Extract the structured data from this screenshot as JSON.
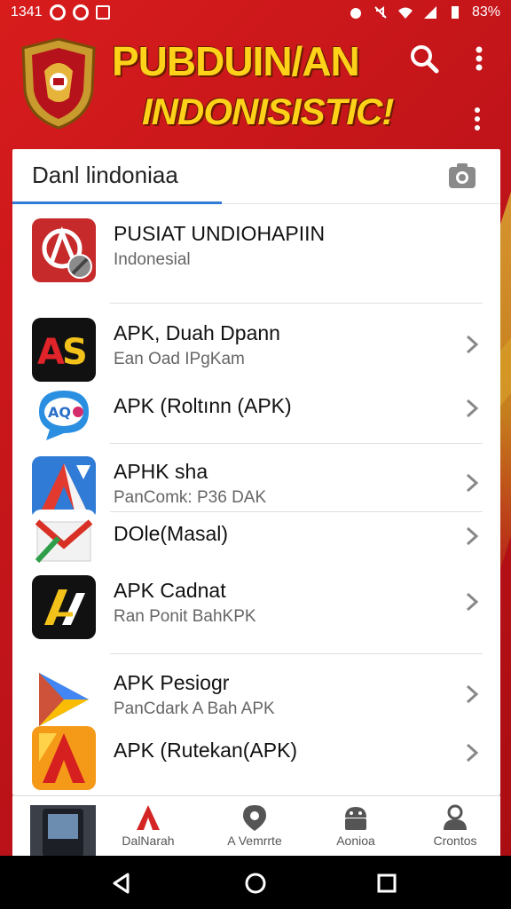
{
  "status_bar": {
    "time": "1341",
    "battery": "83%"
  },
  "header": {
    "title_line1": "PUBDUIN/AN",
    "title_line2": "INDONISISTIC!",
    "icons": [
      "emblem-icon",
      "search-icon",
      "more-vert-icon"
    ]
  },
  "search": {
    "value": "Danl lindoniaa",
    "icon": "camera-icon"
  },
  "list": [
    {
      "title": "PUSIAT UNDIOHAPIIN",
      "subtitle": "Indonesial",
      "icon": "app-icon-red-ban",
      "has_chevron": false
    },
    {
      "title": "APK, Duah Dpann",
      "subtitle": "Ean Oad IPgKam",
      "icon": "app-icon-as",
      "has_chevron": true
    },
    {
      "title": "APK (Roltınn (APK)",
      "subtitle": "",
      "icon": "app-icon-aq-bubble",
      "has_chevron": true
    },
    {
      "title": "APHK sha",
      "subtitle": "PanComk: P36 DAK",
      "icon": "app-icon-blue-a",
      "has_chevron": true
    },
    {
      "title": "DOle(Masal)",
      "subtitle": "",
      "icon": "app-icon-gmail-like",
      "has_chevron": true
    },
    {
      "title": "APK Cadnat",
      "subtitle": "Ran Ponit BahKPK",
      "icon": "app-icon-yellow-a",
      "has_chevron": true
    },
    {
      "title": "APK Pesiogr",
      "subtitle": "PanCdark A Bah APK",
      "icon": "app-icon-play-like",
      "has_chevron": true
    },
    {
      "title": "APK (Rutekan(APK)",
      "subtitle": "",
      "icon": "app-icon-orange-a",
      "has_chevron": true
    }
  ],
  "bottom_nav": {
    "items": [
      {
        "label": "DalNarah",
        "icon": "brand-a-icon",
        "color": "#d42424"
      },
      {
        "label": "A  Vemrrte",
        "icon": "location-icon",
        "color": "#555555"
      },
      {
        "label": "Aonioa",
        "icon": "android-icon",
        "color": "#555555"
      },
      {
        "label": "Crontos",
        "icon": "person-icon",
        "color": "#555555"
      }
    ]
  },
  "colors": {
    "brand_red": "#c8151b",
    "title_yellow": "#ffd21a",
    "accent_blue": "#2f7bd6"
  }
}
